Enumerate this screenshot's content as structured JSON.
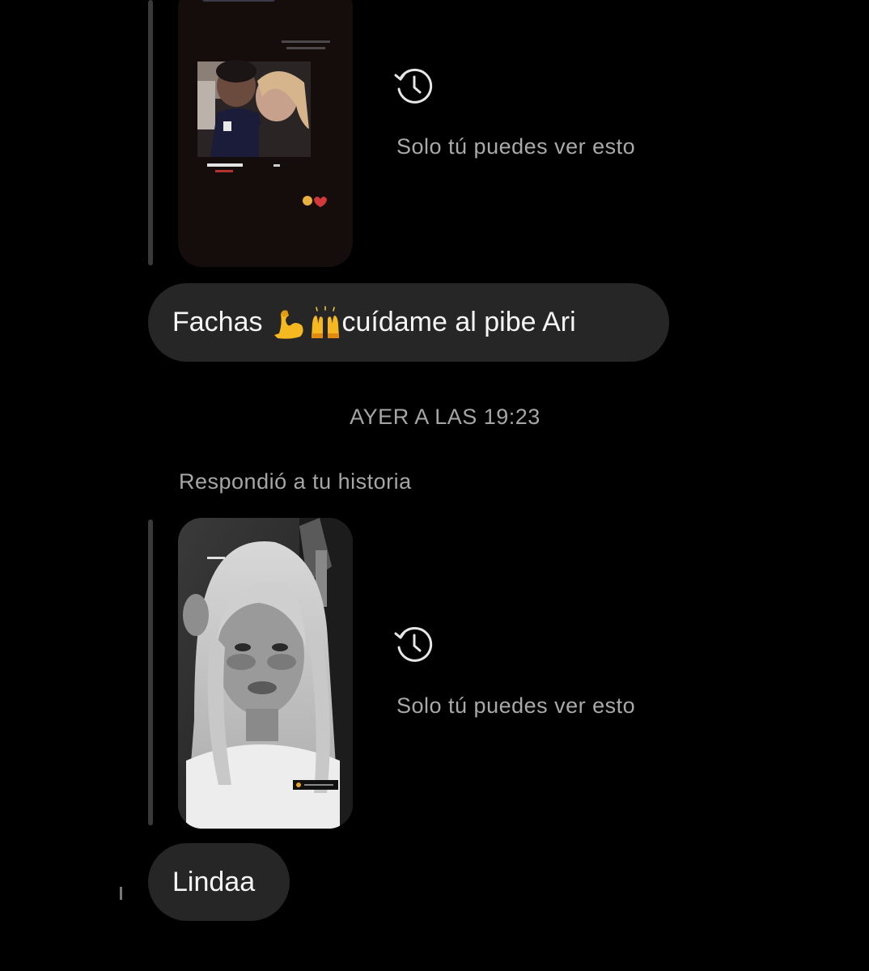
{
  "messages": {
    "story_reply_1": {
      "thumbnail": "story-photo-couple",
      "notice": "Solo tú puedes ver esto",
      "notice_icon": "expired-history-icon"
    },
    "message_1": {
      "prefix": "Fachas ",
      "emojis": [
        "flexed-biceps-emoji",
        "raising-hands-emoji"
      ],
      "suffix": "cuídame al pibe Ari"
    },
    "timestamp": "AYER A LAS 19:23",
    "replied_label": "Respondió a tu historia",
    "story_reply_2": {
      "thumbnail": "story-photo-selfie-bw",
      "notice": "Solo tú puedes ver esto",
      "notice_icon": "expired-history-icon"
    },
    "message_2": {
      "text": "Lindaa"
    }
  },
  "colors": {
    "background": "#000000",
    "bubble": "#262626",
    "muted_text": "#a6a6a6",
    "reply_bar": "#3a3a3a",
    "emoji_yellow": "#f5b820"
  }
}
